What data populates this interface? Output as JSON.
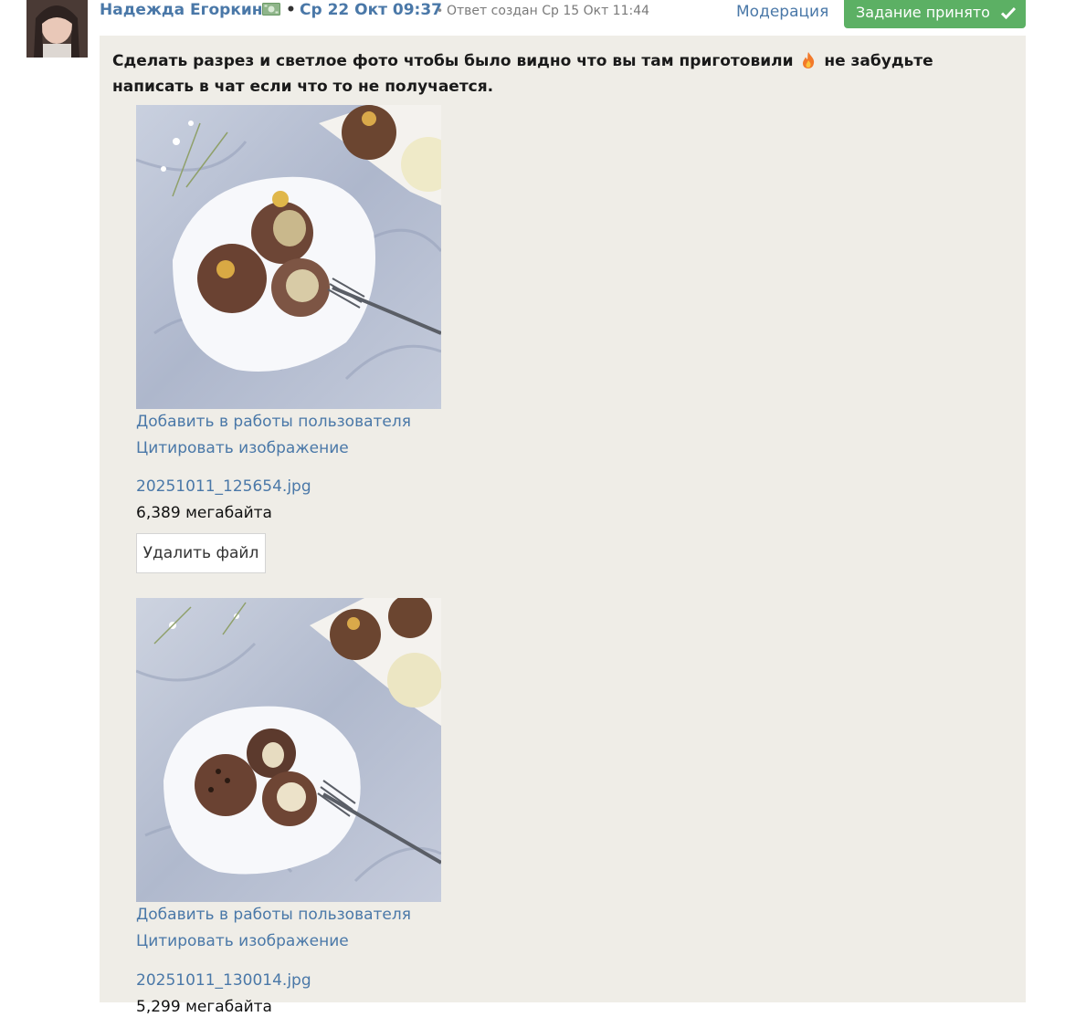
{
  "header": {
    "author": "Надежда Егоркина",
    "separator": "•",
    "date": "Ср 22 Окт 09:37",
    "answer_separator": "•",
    "answer_created": "Ответ создан Ср 15 Окт 11:44",
    "moderation_link": "Модерация",
    "status_button": "Задание принято",
    "icons": {
      "money": "money-icon",
      "check": "check-icon"
    }
  },
  "task": {
    "text_before_icon": "Сделать разрез и светлое фото чтобы было видно что вы там приготовили",
    "icon": "fire-icon",
    "text_after_icon": "не забудьте написать в чат если что то не получается."
  },
  "attachments": [
    {
      "add_to_works": "Добавить в работы пользователя",
      "quote_image": "Цитировать изображение",
      "filename": "20251011_125654.jpg",
      "filesize": "6,389 мегабайта",
      "delete_button": "Удалить файл"
    },
    {
      "add_to_works": "Добавить в работы пользователя",
      "quote_image": "Цитировать изображение",
      "filename": "20251011_130014.jpg",
      "filesize": "5,299 мегабайта"
    }
  ],
  "colors": {
    "link": "#4a78a8",
    "accepted": "#5cb064",
    "card_bg": "#efede7"
  }
}
